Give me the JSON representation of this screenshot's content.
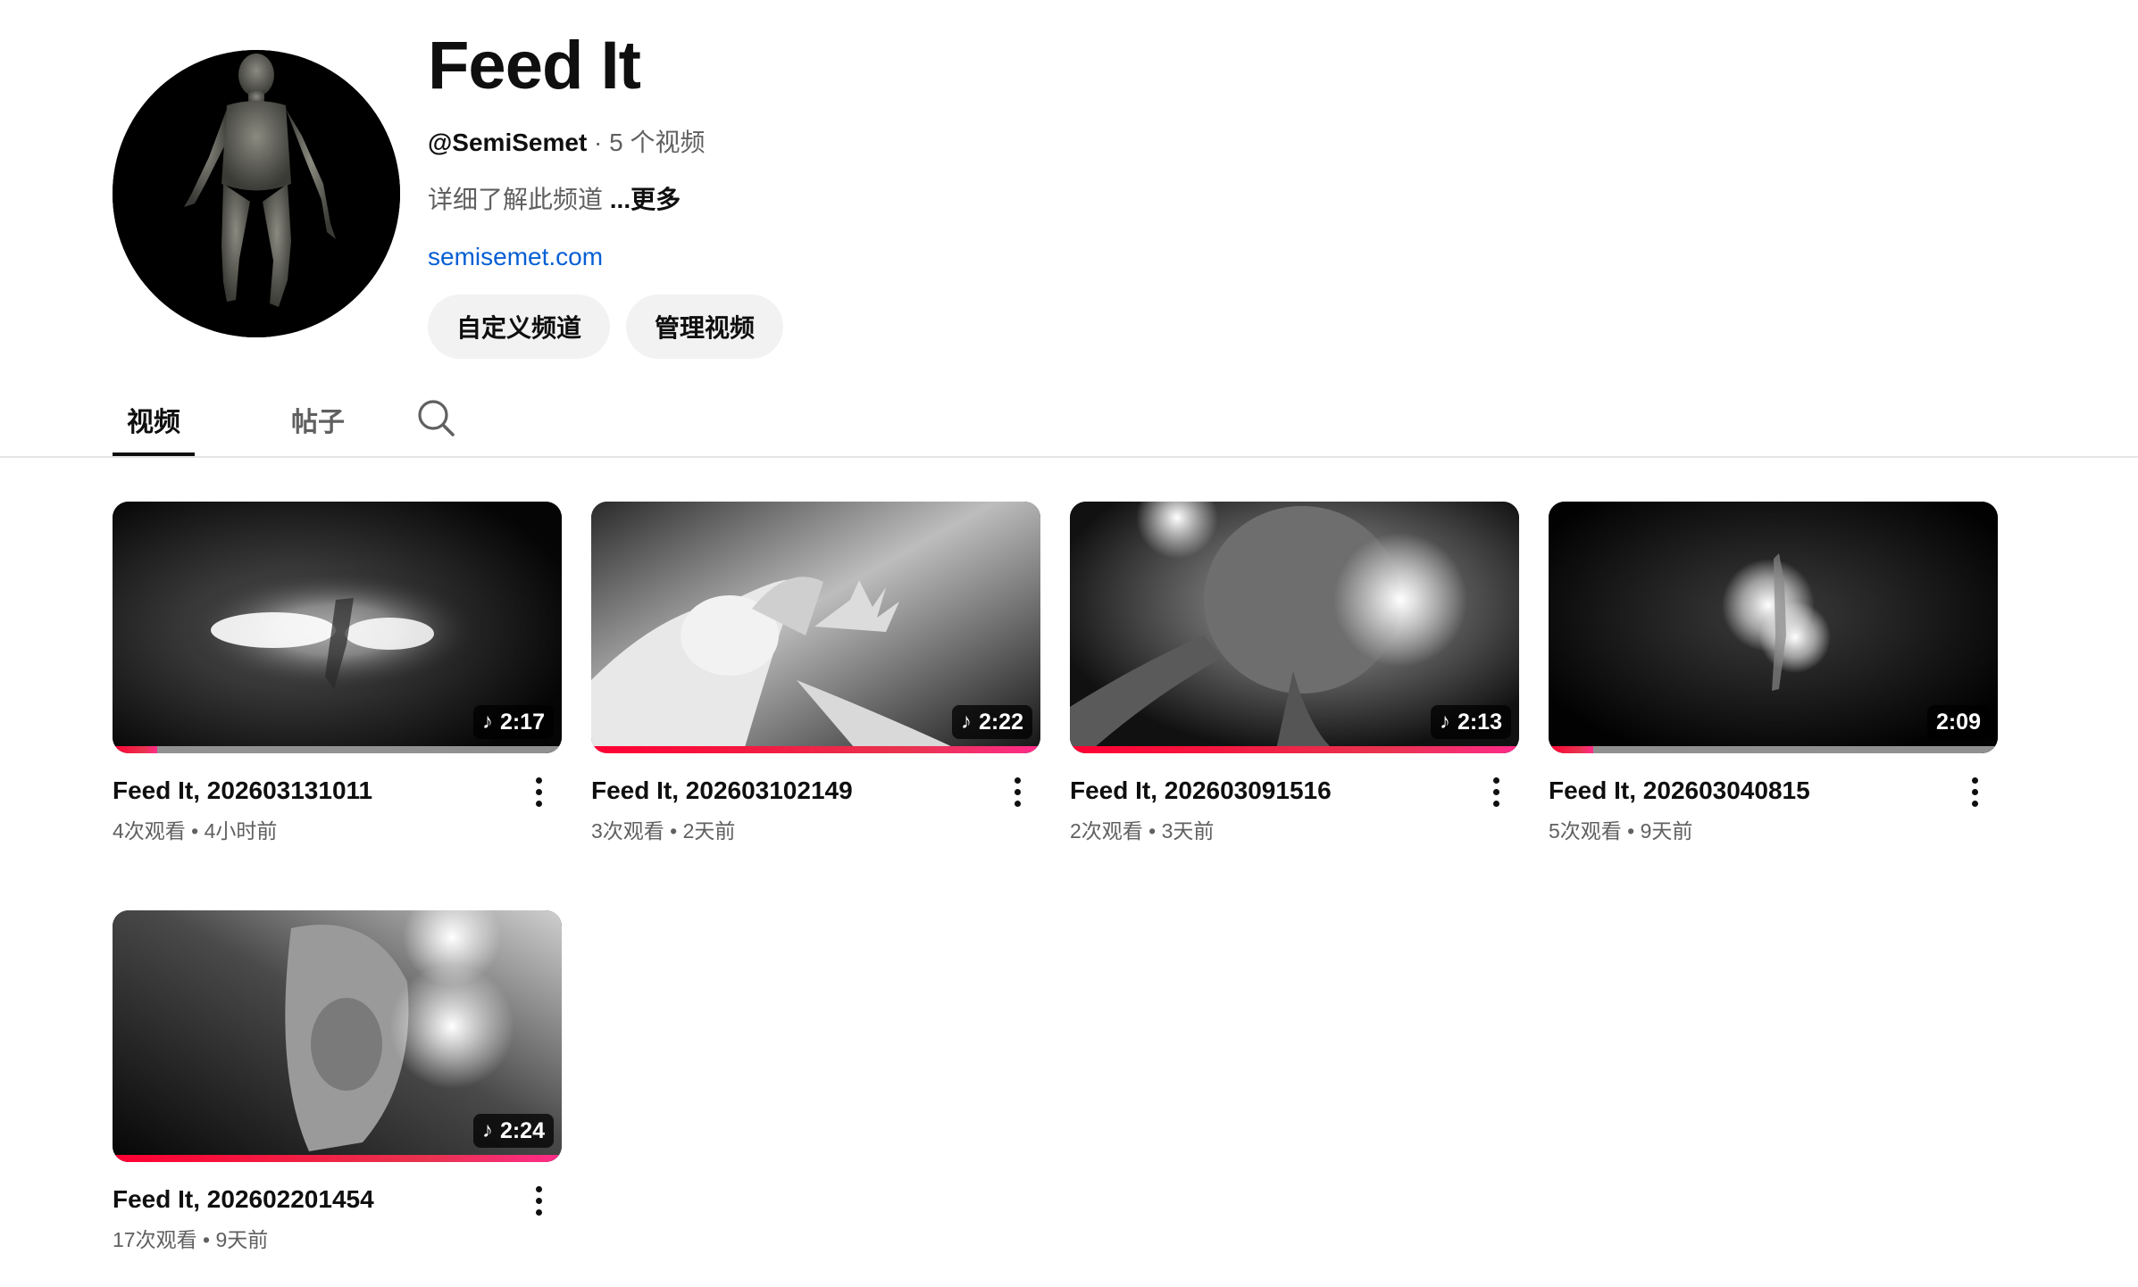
{
  "channel": {
    "title": "Feed It",
    "handle": "@SemiSemet",
    "meta_separator": " · ",
    "video_count": "5 个视频",
    "description": "详细了解此频道 ",
    "more_label": "...更多",
    "link": "semisemet.com",
    "buttons": {
      "customize": "自定义频道",
      "manage": "管理视频"
    }
  },
  "tabs": [
    {
      "label": "视频",
      "active": true
    },
    {
      "label": "帖子",
      "active": false
    }
  ],
  "search_icon": "search-icon",
  "videos": [
    {
      "title": "Feed It, 202603131011",
      "views": "4次观看",
      "age": "4小时前",
      "duration": "2:17",
      "audio_icon": "music-note-icon",
      "progress": 0.1
    },
    {
      "title": "Feed It, 202603102149",
      "views": "3次观看",
      "age": "2天前",
      "duration": "2:22",
      "audio_icon": "music-note-icon",
      "progress": 1.0
    },
    {
      "title": "Feed It, 202603091516",
      "views": "2次观看",
      "age": "3天前",
      "duration": "2:13",
      "audio_icon": "music-note-icon",
      "progress": 1.0
    },
    {
      "title": "Feed It, 202603040815",
      "views": "5次观看",
      "age": "9天前",
      "duration": "2:09",
      "audio_icon": "",
      "progress": 0.1
    },
    {
      "title": "Feed It, 202602201454",
      "views": "17次观看",
      "age": "9天前",
      "duration": "2:24",
      "audio_icon": "music-note-icon",
      "progress": 1.0
    }
  ],
  "meta_dot": " • ",
  "colors": {
    "link": "#065fd4",
    "progress": "#ff0033",
    "pill_bg": "#f2f2f2"
  }
}
